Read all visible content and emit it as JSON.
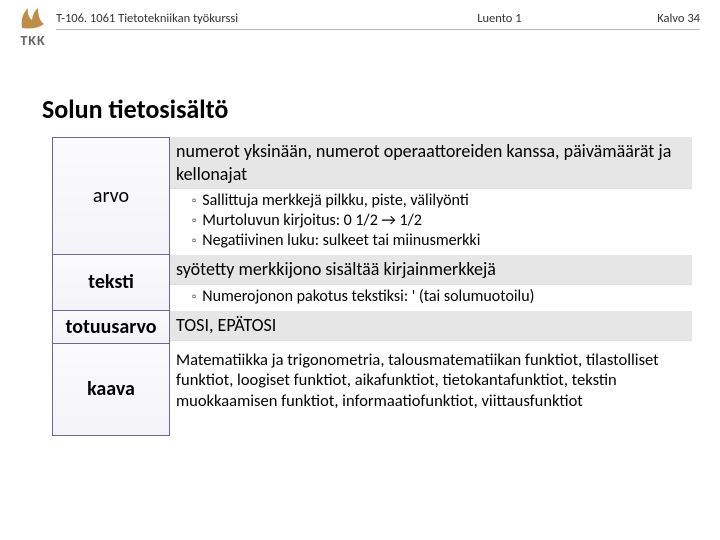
{
  "header": {
    "course": "T-106. 1061 Tietotekniikan työkurssi",
    "lecture": "Luento 1",
    "slide": "Kalvo 34",
    "logo_text": "TKK"
  },
  "title": "Solun tietosisältö",
  "rows": [
    {
      "label": "arvo",
      "header": "numerot yksinään, numerot operaattoreiden kanssa, päivämäärät ja kellonajat",
      "bullets": [
        "Sallittuja merkkejä pilkku, piste, välilyönti",
        "Murtoluvun kirjoitus: 0 1/2 → 1/2",
        "Negatiivinen luku: sulkeet tai miinusmerkki"
      ]
    },
    {
      "label": "teksti",
      "header": "syötetty merkkijono sisältää kirjainmerkkejä",
      "bullets": [
        "Numerojonon pakotus tekstiksi: ' (tai solumuotoilu)"
      ]
    },
    {
      "label": "totuusarvo",
      "header": "TOSI, EPÄTOSI",
      "bullets": []
    },
    {
      "label": "kaava",
      "header": "",
      "body": "Matematiikka ja trigonometria, talousmatematiikan funktiot, tilastolliset funktiot, loogiset funktiot, aikafunktiot, tietokantafunktiot, tekstin muokkaamisen funktiot, informaatiofunktiot, viittausfunktiot"
    }
  ]
}
